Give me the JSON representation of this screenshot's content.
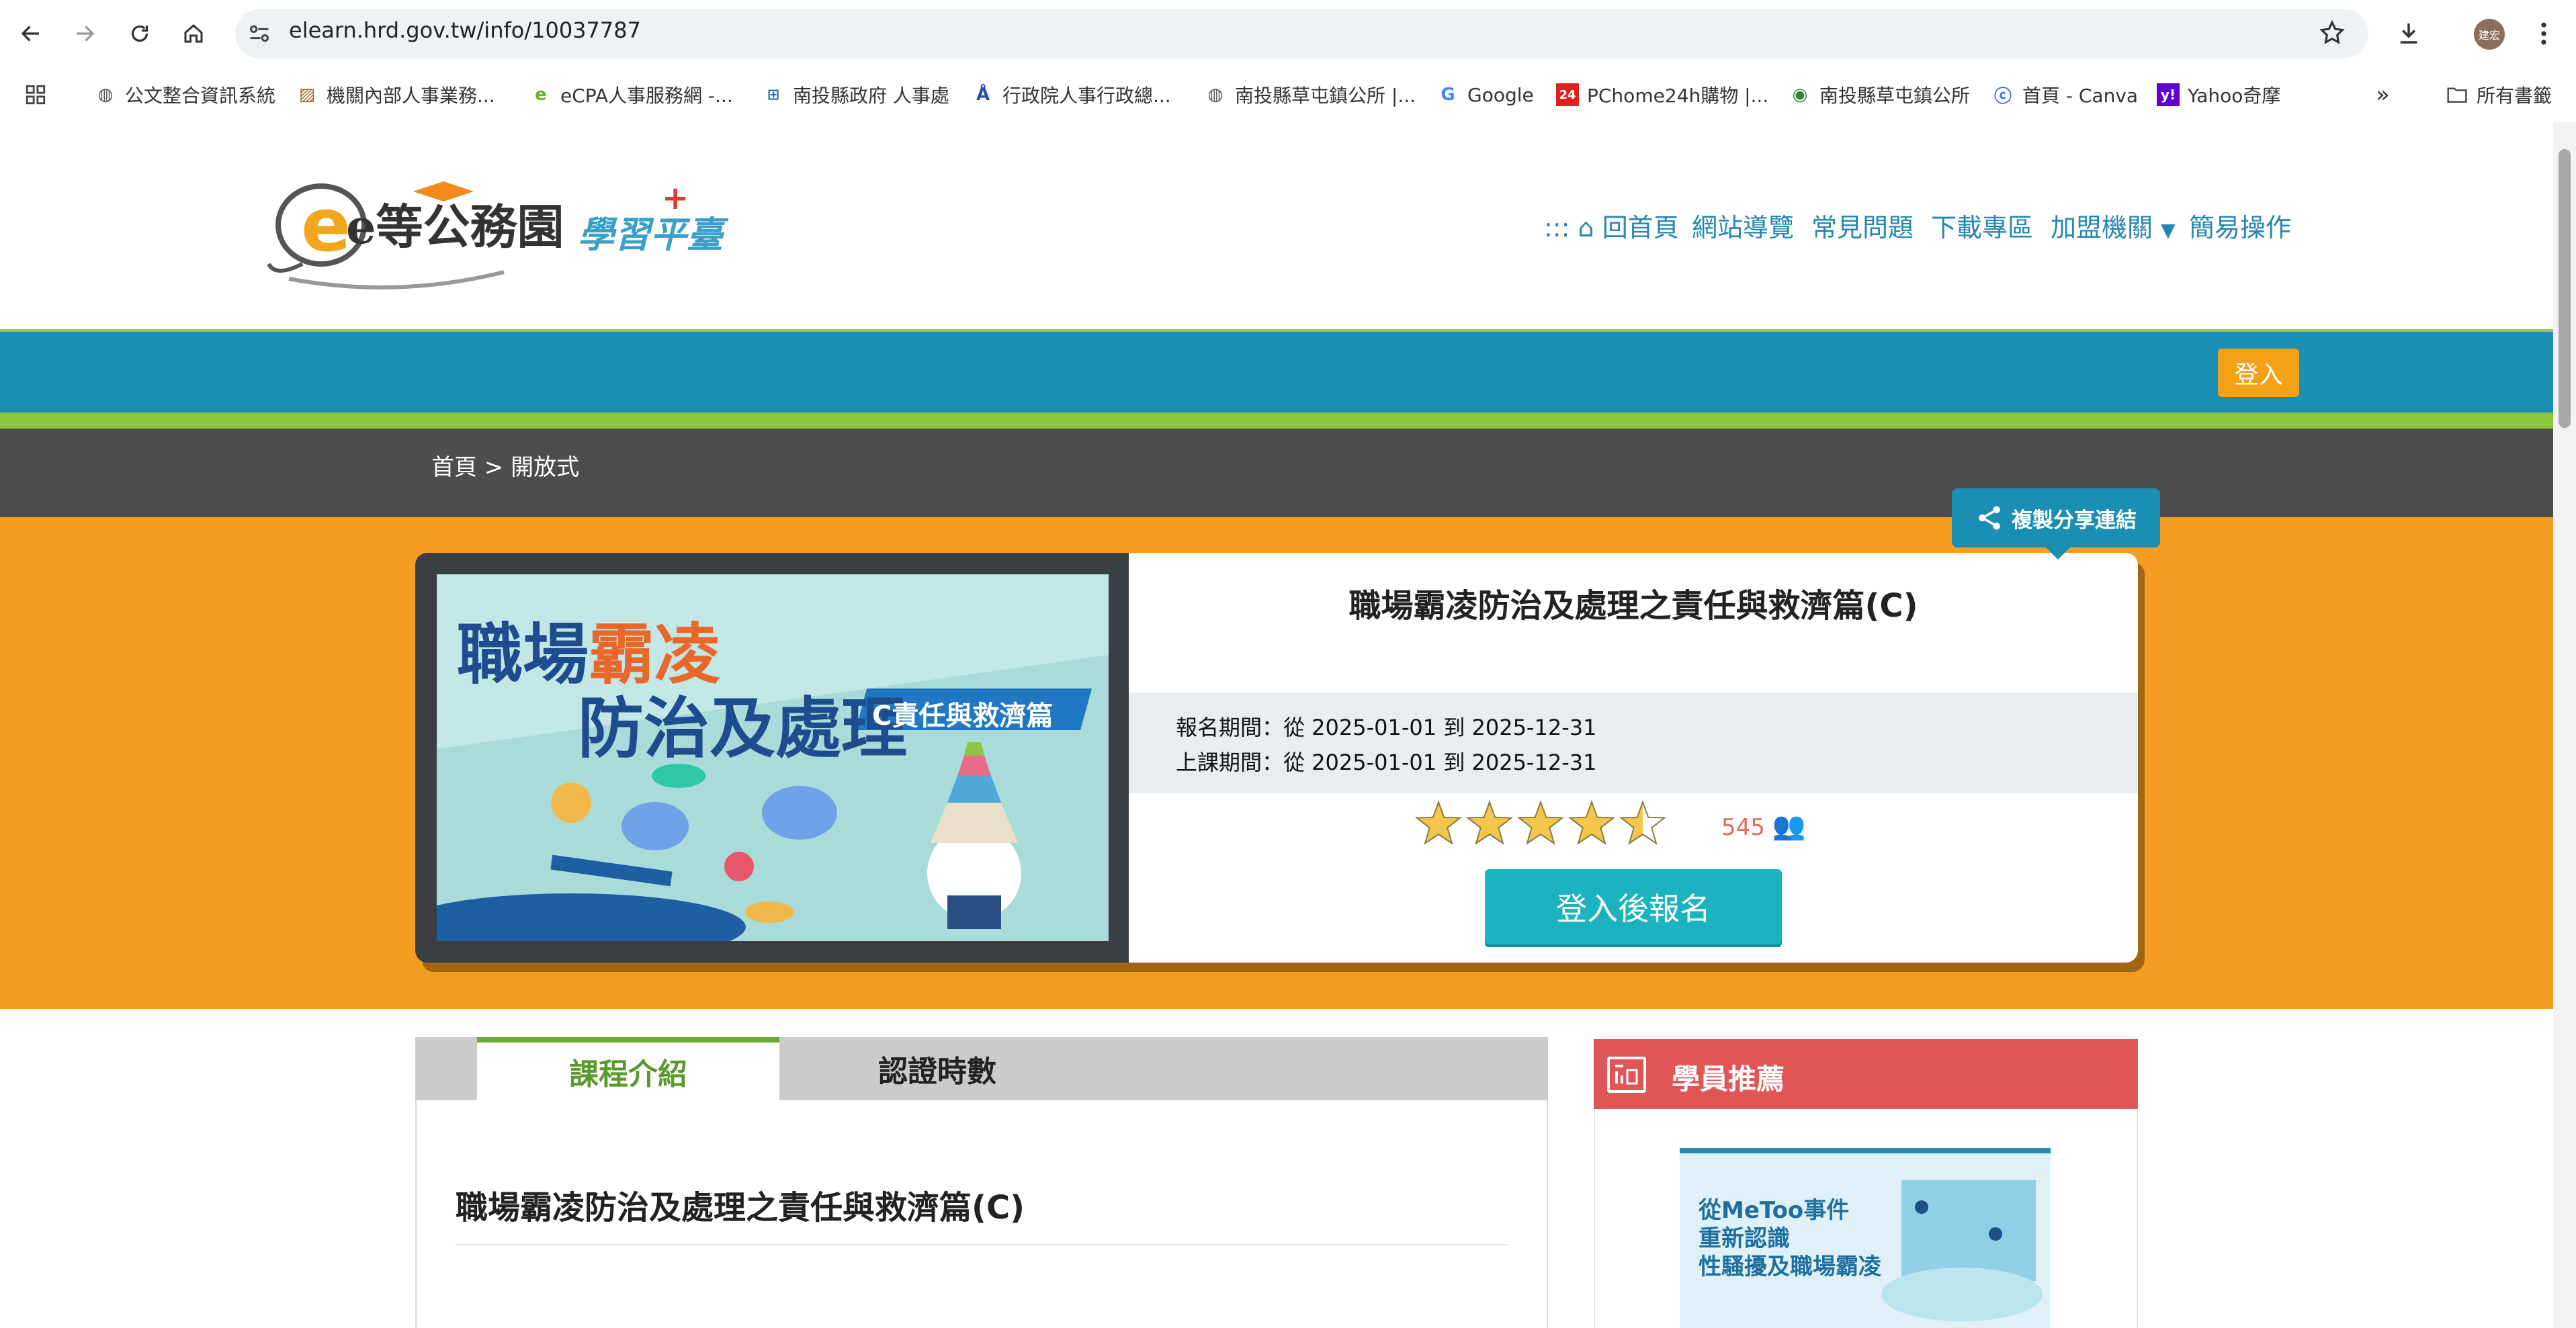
{
  "browser": {
    "url": "elearn.hrd.gov.tw/info/10037787",
    "profile_label": "建宏",
    "bookmarks": [
      {
        "label": "公文整合資訊系統",
        "icon": "globe-icon"
      },
      {
        "label": "機關內部人事業務...",
        "icon": "image-icon"
      },
      {
        "label": "eCPA人事服務網 -...",
        "icon": "ecpa-icon"
      },
      {
        "label": "南投縣政府 人事處",
        "icon": "nantou-icon"
      },
      {
        "label": "行政院人事行政總...",
        "icon": "dgpa-icon"
      },
      {
        "label": "南投縣草屯鎮公所 |...",
        "icon": "globe-icon"
      },
      {
        "label": "Google",
        "icon": "google-icon"
      },
      {
        "label": "PChome24h購物 |...",
        "icon": "pchome-icon"
      },
      {
        "label": "南投縣草屯鎮公所",
        "icon": "seal-icon"
      },
      {
        "label": "首頁 - Canva",
        "icon": "canva-icon"
      },
      {
        "label": "Yahoo奇摩",
        "icon": "yahoo-icon"
      }
    ],
    "all_bookmarks": "所有書籤"
  },
  "site": {
    "logo_main": "e等公務園",
    "logo_sub": "學習平臺",
    "nav": {
      "prefix": ":::",
      "home": "回首頁",
      "guide": "網站導覽",
      "faq": "常見問題",
      "download": "下載專區",
      "agencies": "加盟機關",
      "easy": "簡易操作"
    },
    "login": "登入",
    "breadcrumb": "首頁 > 開放式",
    "accent_colors": {
      "blue": "#1b8eb4",
      "orange": "#f59d20",
      "green": "#8cc63f",
      "red": "#e05555"
    }
  },
  "course": {
    "title": "職場霸凌防治及處理之責任與救濟篇(C)",
    "share": "複製分享連結",
    "enroll_period": "報名期間：從 2025-01-01 到 2025-12-31",
    "class_period": "上課期間：從 2025-01-01 到 2025-12-31",
    "rating": 4.5,
    "rating_count": "545",
    "enroll_button": "登入後報名",
    "image": {
      "line1a": "職場",
      "line1b": "霸凌",
      "line2a": "防治及",
      "line2b": "處理",
      "tag": "C責任與救濟篇"
    }
  },
  "tabs": {
    "intro": "課程介紹",
    "hours": "認證時數"
  },
  "content": {
    "title": "職場霸凌防治及處理之責任與救濟篇(C)"
  },
  "sidebar": {
    "title": "學員推薦",
    "card_line1": "從MeToo事件",
    "card_line2": "重新認識",
    "card_line3": "性騷擾及職場霸凌"
  }
}
